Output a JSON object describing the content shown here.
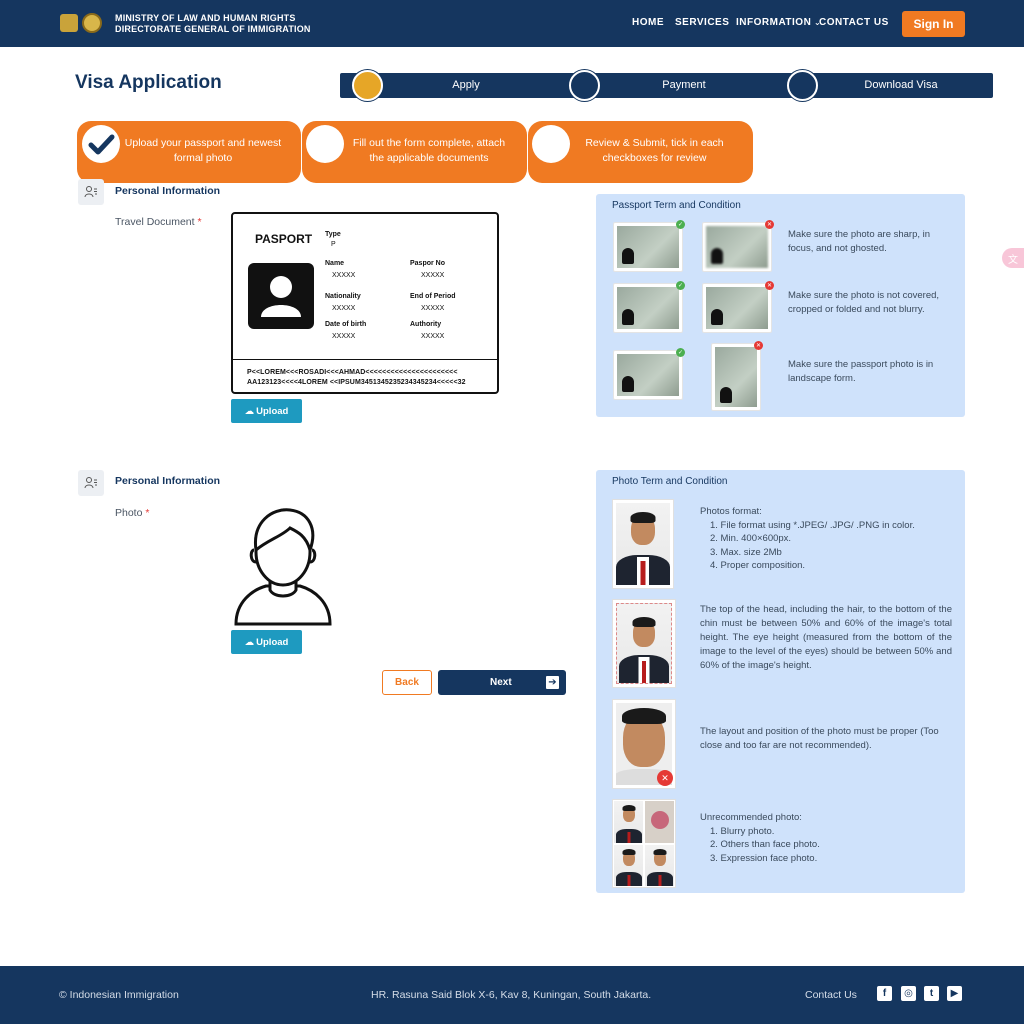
{
  "header": {
    "org_line1": "MINISTRY OF  LAW  AND HUMAN RIGHTS",
    "org_line2": "DIRECTORATE GENERAL OF IMMIGRATION",
    "nav": [
      "HOME",
      "SERVICES",
      "INFORMATION",
      "CONTACT US"
    ],
    "signin": "Sign In"
  },
  "page": {
    "title": "Visa Application"
  },
  "progress_steps": [
    {
      "label": "Apply",
      "active": true
    },
    {
      "label": "Payment",
      "active": false
    },
    {
      "label": "Download Visa",
      "active": false
    }
  ],
  "instructions": [
    {
      "text": "Upload your passport and newest formal photo",
      "done": true
    },
    {
      "text": "Fill out the form complete, attach the applicable documents",
      "done": false
    },
    {
      "text": "Review & Submit, tick in each checkboxes for review",
      "done": false
    }
  ],
  "section1": {
    "title": "Personal Information",
    "field_label": "Travel Document",
    "required_mark": "*",
    "passport": {
      "title": "PASPORT",
      "type_label": "Type",
      "type_value": "P",
      "name_label": "Name",
      "name_value": "XXXXX",
      "paspor_no_label": "Paspor No",
      "paspor_no_value": "XXXXX",
      "nationality_label": "Nationality",
      "nationality_value": "XXXXX",
      "end_label": "End of Period",
      "end_value": "XXXXX",
      "dob_label": "Date of birth",
      "dob_value": "XXXXX",
      "authority_label": "Authority",
      "authority_value": "XXXXX",
      "mrz1": "P<<LOREM<<<ROSADI<<<AHMAD<<<<<<<<<<<<<<<<<<<<<<",
      "mrz2": "AA123123<<<<4LOREM <<IPSUM34513452352343452​34<<<<<32"
    },
    "upload": "Upload"
  },
  "passport_terms": {
    "title": "Passport Term and Condition",
    "items": [
      "Make sure the photo are sharp, in focus, and not ghosted.",
      "Make sure the photo is not covered, cropped or folded and not blurry.",
      "Make sure the passport photo is in landscape form."
    ]
  },
  "section2": {
    "title": "Personal Information",
    "field_label": "Photo",
    "required_mark": "*",
    "upload": "Upload"
  },
  "buttons": {
    "back": "Back",
    "next": "Next"
  },
  "photo_terms": {
    "title": "Photo Term and Condition",
    "format_title": "Photos format:",
    "format_items": [
      "1. File format using *.JPEG/ .JPG/ .PNG in color.",
      "2. Min. 400×600px.",
      "3. Max. size 2Mb",
      "4. Proper composition."
    ],
    "head_text": "The top of the head, including the hair, to the bottom of the chin must be between 50% and 60% of the image's total height. The eye height (measured from the bottom of the image to the level of the eyes) should be between 50% and 60% of the image's height.",
    "layout_text": "The layout and position of the photo must be proper (Too close and too far are not recommended).",
    "unrec_title": "Unrecommended photo:",
    "unrec_items": [
      "1. Blurry photo.",
      "2. Others than face photo.",
      "3. Expression face photo."
    ]
  },
  "footer": {
    "copyright": "© Indonesian Immigration",
    "address": "HR. Rasuna Said Blok X-6, Kav 8, Kuningan, South Jakarta.",
    "contact": "Contact Us"
  },
  "colors": {
    "navy": "#15365f",
    "orange": "#f07a22",
    "panel": "#cfe2fb",
    "upload": "#1e9ac0"
  }
}
